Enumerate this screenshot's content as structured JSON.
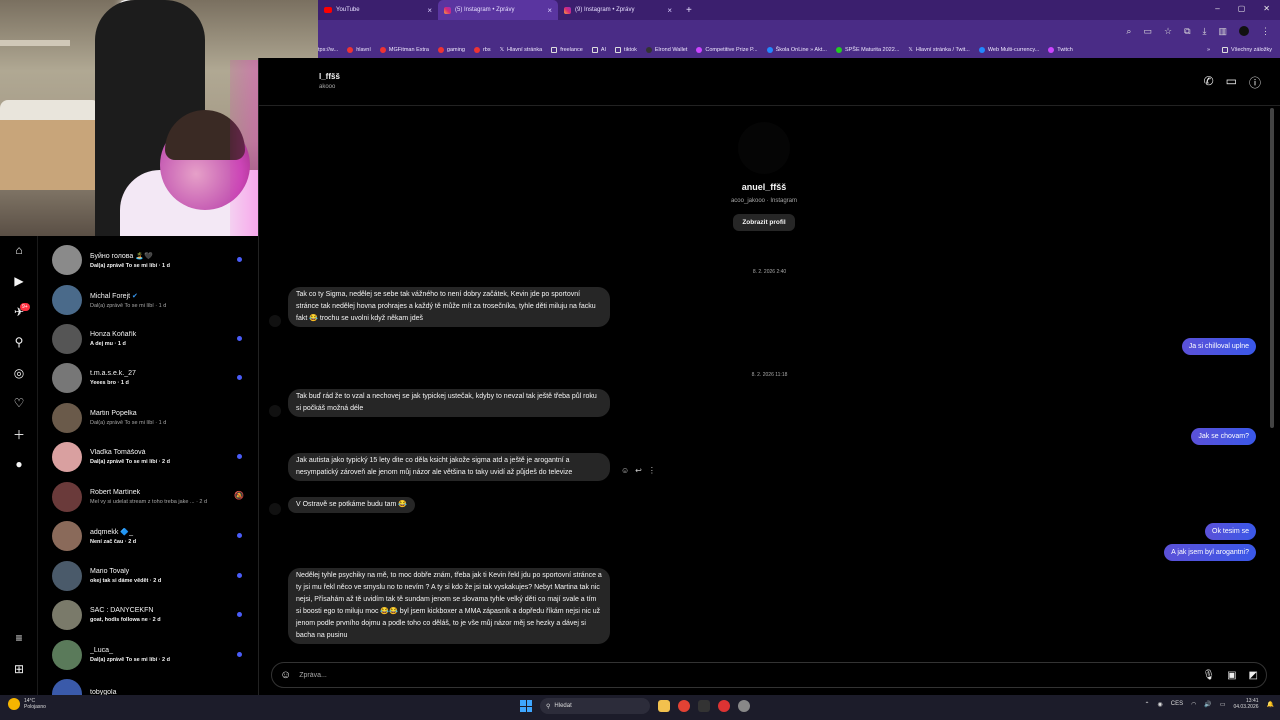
{
  "browser": {
    "tabs": [
      {
        "label": "YouTube"
      },
      {
        "label": "(5) Instagram • Zprávy"
      },
      {
        "label": "(9) Instagram • Zprávy"
      }
    ],
    "bookmarks": [
      "tps://w...",
      "hlavní",
      "MGFitman Extra",
      "gaming",
      "rbs",
      "Hlavní stránka",
      "freelance",
      "AI",
      "tiktok",
      "Elrond Wallet",
      "Competitive Prize P...",
      "Škola OnLine » Akt...",
      "SPŠE Maturita 2022...",
      "Hlavní stránka / Twit...",
      "Web Multi-currency...",
      "Twitch"
    ],
    "bookmarks_more": "Všechny záložky"
  },
  "rail": {
    "badge": "9+"
  },
  "conversations": [
    {
      "name": "Буйно голова 🏝️🖤",
      "preview": "Dal(a) zprávě To se mi líbí · 1 d",
      "unread": true,
      "avatar_color": "#8a8a8a"
    },
    {
      "name": "Michal Forejt",
      "verified": "✔",
      "preview": "Dal(a) zprávě To se mi líbí · 1 d",
      "unread": false,
      "avatar_color": "#4a6a8a"
    },
    {
      "name": "Honza Koňařík",
      "preview": "A dej mu · 1 d",
      "unread": true,
      "avatar_color": "#555"
    },
    {
      "name": "t.m.a.s.e.k._27",
      "preview": "Yeees bro · 1 d",
      "unread": true,
      "avatar_color": "#777"
    },
    {
      "name": "Martin Popelka",
      "preview": "Dal(a) zprávě To se mi líbí · 1 d",
      "unread": false,
      "avatar_color": "#6a5a4a"
    },
    {
      "name": "Vlaďka Tomášová",
      "preview": "Dal(a) zprávě To se mi líbí · 2 d",
      "unread": true,
      "avatar_color": "#d9a0a0"
    },
    {
      "name": "Robert Martínek",
      "preview": "Mel vy si udelat stream z toho treba jake ... · 2 d",
      "unread": false,
      "muted": true,
      "avatar_color": "#6a3a3a"
    },
    {
      "name": "adqmekk 🔷_",
      "preview": "Není zač čau · 2 d",
      "unread": true,
      "avatar_color": "#8a6a5a"
    },
    {
      "name": "Mario Tovaly",
      "preview": "okej tak si dáme vědět · 2 d",
      "unread": true,
      "avatar_color": "#4a5a6a"
    },
    {
      "name": "SAC : DANYCEKFN",
      "preview": "goat, hodis followa ne · 2 d",
      "unread": true,
      "avatar_color": "#7a7a6a"
    },
    {
      "name": "_Luca_",
      "preview": "Dal(a) zprávě To se mi líbí · 2 d",
      "unread": true,
      "avatar_color": "#5a7a5a"
    },
    {
      "name": "tobygola",
      "preview": "",
      "unread": false,
      "avatar_color": "#3a5aaa"
    }
  ],
  "chat": {
    "header_name": "l_ffšš",
    "header_sub": "akooo",
    "profile_name": "anuel_ffšš",
    "profile_sub": "acoo_jakooo · Instagram",
    "profile_button": "Zobrazit profil",
    "timestamps": [
      "8. 2. 2026 2:40",
      "8. 2. 2026 11:18"
    ],
    "incoming": [
      "Tak co ty Sigma, nedělej se sebe tak vážného to není dobry začátek, Kevin jde po sportovní stránce tak nedělej hovna prohrajes a každý tě může mít za trosečníka, tyhle děti miluju na facku fakt 😂 trochu se uvolni když někam jdeš",
      "Tak buď rád že to vzal a nechovej se jak typickej ustečak, kdyby to nevzal tak ještě třeba půl roku si počkáš možná déle",
      "Jak autista jako typický 15 lety dite co děla ksicht jakože sigma atd   a ještě je arogantní a nesympatický zároveň ale jenom můj názor ale většina to taky uvidí až půjdeš do televize",
      "V Ostravě se potkáme budu tam 😂",
      "Nedělej tyhle psychiky na mě, to moc dobře znám, třeba jak ti Kevin řekl jdu po sportovní stránce a ty jsi mu řekl něco ve smyslu no to nevím ? A ty si kdo že jsi tak vyskakujes? Nebyt Martina tak nic nejsi, Přísahám až tě uvidím tak tě sundam jenom se slovama tyhle velký děti co mají svale a tím si boosti ego to miluju moc 😂😂 byl jsem kickboxer a MMA zápasník a dopředu říkám nejsi nic už jenom podle prvního dojmu a podle toho co děláš, to je vše můj názor  měj se hezky a dávej si bacha na pusinu"
    ],
    "outgoing": [
      "Ja si chillоval uplne",
      "Jak se chovam?",
      "Ok tesim se",
      "A jak jsem byl arogantni?"
    ],
    "composer_placeholder": "Zpráva..."
  },
  "taskbar": {
    "temp": "14°C",
    "weather": "Polojasno",
    "search": "Hledat",
    "lang": "CES",
    "time": "13:41",
    "date": "04.03.2026"
  },
  "colors": {
    "accent": "#3a58e8",
    "bubble_in": "#262626",
    "unread_dot": "#4a5df9",
    "browser_frame": "#4a2c86"
  }
}
